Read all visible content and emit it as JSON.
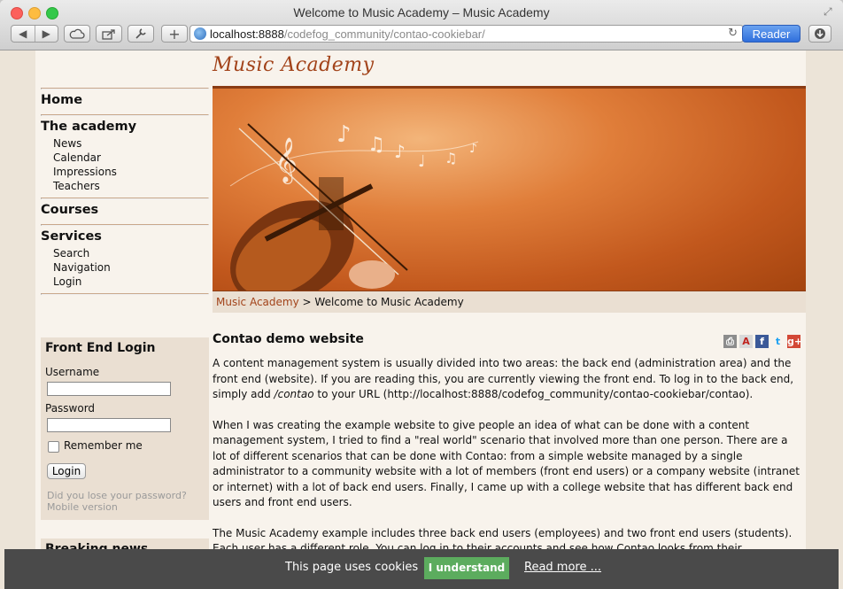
{
  "browser": {
    "window_title": "Welcome to Music Academy – Music Academy",
    "url_host": "localhost:8888",
    "url_path": "/codefog_community/contao-cookiebar/",
    "reader_label": "Reader"
  },
  "site": {
    "logo": "Music Academy"
  },
  "nav": {
    "home": "Home",
    "academy": "The academy",
    "academy_items": [
      "News",
      "Calendar",
      "Impressions",
      "Teachers"
    ],
    "courses": "Courses",
    "services": "Services",
    "services_items": [
      "Search",
      "Navigation",
      "Login"
    ]
  },
  "breadcrumb": {
    "root": "Music Academy",
    "separator": ">",
    "current": "Welcome to Music Academy"
  },
  "login": {
    "title": "Front End Login",
    "username_label": "Username",
    "password_label": "Password",
    "remember_label": "Remember me",
    "submit_label": "Login",
    "lost_password": "Did you lose your password?",
    "mobile_version": "Mobile version"
  },
  "news": {
    "title": "Breaking news"
  },
  "article": {
    "heading": "Contao demo website",
    "p1_a": "A content management system is usually divided into two areas: the back end (administration area) and the front end (website). If you are reading this, you are currently viewing the front end. To log in to the back end, simply add ",
    "p1_em": "/contao",
    "p1_b": " to your URL (http://localhost:8888/codefog_community/contao-cookiebar/contao).",
    "p2": "When I was creating the example website to give people an idea of what can be done with a content management system, I tried to find a \"real world\" scenario that involved more than one person. There are a lot of different scenarios that can be done with Contao: from a simple website managed by a single administrator to a community website with a lot of members (front end users) or a company website (intranet or internet) with a lot of back end users. Finally, I came up with a college website that has different back end users and front end users.",
    "p3": "The Music Academy example includes three back end users (employees) and two front end users (students). Each user has a different role. You can log in to their accounts and see how Contao looks from their perspective. Please note that"
  },
  "cookiebar": {
    "message": "This page uses cookies",
    "accept_label": "I understand",
    "read_more": "Read more ..."
  },
  "colors": {
    "brand": "#a2431a",
    "accept": "#5cac5e",
    "cookie_bg": "#4a4a4a"
  }
}
